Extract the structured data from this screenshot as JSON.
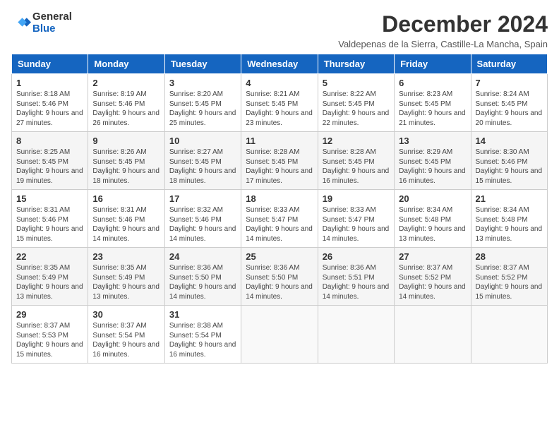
{
  "logo": {
    "general": "General",
    "blue": "Blue"
  },
  "title": "December 2024",
  "location": "Valdepenas de la Sierra, Castille-La Mancha, Spain",
  "headers": [
    "Sunday",
    "Monday",
    "Tuesday",
    "Wednesday",
    "Thursday",
    "Friday",
    "Saturday"
  ],
  "weeks": [
    [
      {
        "day": "1",
        "info": "Sunrise: 8:18 AM\nSunset: 5:46 PM\nDaylight: 9 hours and 27 minutes."
      },
      {
        "day": "2",
        "info": "Sunrise: 8:19 AM\nSunset: 5:46 PM\nDaylight: 9 hours and 26 minutes."
      },
      {
        "day": "3",
        "info": "Sunrise: 8:20 AM\nSunset: 5:45 PM\nDaylight: 9 hours and 25 minutes."
      },
      {
        "day": "4",
        "info": "Sunrise: 8:21 AM\nSunset: 5:45 PM\nDaylight: 9 hours and 23 minutes."
      },
      {
        "day": "5",
        "info": "Sunrise: 8:22 AM\nSunset: 5:45 PM\nDaylight: 9 hours and 22 minutes."
      },
      {
        "day": "6",
        "info": "Sunrise: 8:23 AM\nSunset: 5:45 PM\nDaylight: 9 hours and 21 minutes."
      },
      {
        "day": "7",
        "info": "Sunrise: 8:24 AM\nSunset: 5:45 PM\nDaylight: 9 hours and 20 minutes."
      }
    ],
    [
      {
        "day": "8",
        "info": "Sunrise: 8:25 AM\nSunset: 5:45 PM\nDaylight: 9 hours and 19 minutes."
      },
      {
        "day": "9",
        "info": "Sunrise: 8:26 AM\nSunset: 5:45 PM\nDaylight: 9 hours and 18 minutes."
      },
      {
        "day": "10",
        "info": "Sunrise: 8:27 AM\nSunset: 5:45 PM\nDaylight: 9 hours and 18 minutes."
      },
      {
        "day": "11",
        "info": "Sunrise: 8:28 AM\nSunset: 5:45 PM\nDaylight: 9 hours and 17 minutes."
      },
      {
        "day": "12",
        "info": "Sunrise: 8:28 AM\nSunset: 5:45 PM\nDaylight: 9 hours and 16 minutes."
      },
      {
        "day": "13",
        "info": "Sunrise: 8:29 AM\nSunset: 5:45 PM\nDaylight: 9 hours and 16 minutes."
      },
      {
        "day": "14",
        "info": "Sunrise: 8:30 AM\nSunset: 5:46 PM\nDaylight: 9 hours and 15 minutes."
      }
    ],
    [
      {
        "day": "15",
        "info": "Sunrise: 8:31 AM\nSunset: 5:46 PM\nDaylight: 9 hours and 15 minutes."
      },
      {
        "day": "16",
        "info": "Sunrise: 8:31 AM\nSunset: 5:46 PM\nDaylight: 9 hours and 14 minutes."
      },
      {
        "day": "17",
        "info": "Sunrise: 8:32 AM\nSunset: 5:46 PM\nDaylight: 9 hours and 14 minutes."
      },
      {
        "day": "18",
        "info": "Sunrise: 8:33 AM\nSunset: 5:47 PM\nDaylight: 9 hours and 14 minutes."
      },
      {
        "day": "19",
        "info": "Sunrise: 8:33 AM\nSunset: 5:47 PM\nDaylight: 9 hours and 14 minutes."
      },
      {
        "day": "20",
        "info": "Sunrise: 8:34 AM\nSunset: 5:48 PM\nDaylight: 9 hours and 13 minutes."
      },
      {
        "day": "21",
        "info": "Sunrise: 8:34 AM\nSunset: 5:48 PM\nDaylight: 9 hours and 13 minutes."
      }
    ],
    [
      {
        "day": "22",
        "info": "Sunrise: 8:35 AM\nSunset: 5:49 PM\nDaylight: 9 hours and 13 minutes."
      },
      {
        "day": "23",
        "info": "Sunrise: 8:35 AM\nSunset: 5:49 PM\nDaylight: 9 hours and 13 minutes."
      },
      {
        "day": "24",
        "info": "Sunrise: 8:36 AM\nSunset: 5:50 PM\nDaylight: 9 hours and 14 minutes."
      },
      {
        "day": "25",
        "info": "Sunrise: 8:36 AM\nSunset: 5:50 PM\nDaylight: 9 hours and 14 minutes."
      },
      {
        "day": "26",
        "info": "Sunrise: 8:36 AM\nSunset: 5:51 PM\nDaylight: 9 hours and 14 minutes."
      },
      {
        "day": "27",
        "info": "Sunrise: 8:37 AM\nSunset: 5:52 PM\nDaylight: 9 hours and 14 minutes."
      },
      {
        "day": "28",
        "info": "Sunrise: 8:37 AM\nSunset: 5:52 PM\nDaylight: 9 hours and 15 minutes."
      }
    ],
    [
      {
        "day": "29",
        "info": "Sunrise: 8:37 AM\nSunset: 5:53 PM\nDaylight: 9 hours and 15 minutes."
      },
      {
        "day": "30",
        "info": "Sunrise: 8:37 AM\nSunset: 5:54 PM\nDaylight: 9 hours and 16 minutes."
      },
      {
        "day": "31",
        "info": "Sunrise: 8:38 AM\nSunset: 5:54 PM\nDaylight: 9 hours and 16 minutes."
      },
      null,
      null,
      null,
      null
    ]
  ]
}
